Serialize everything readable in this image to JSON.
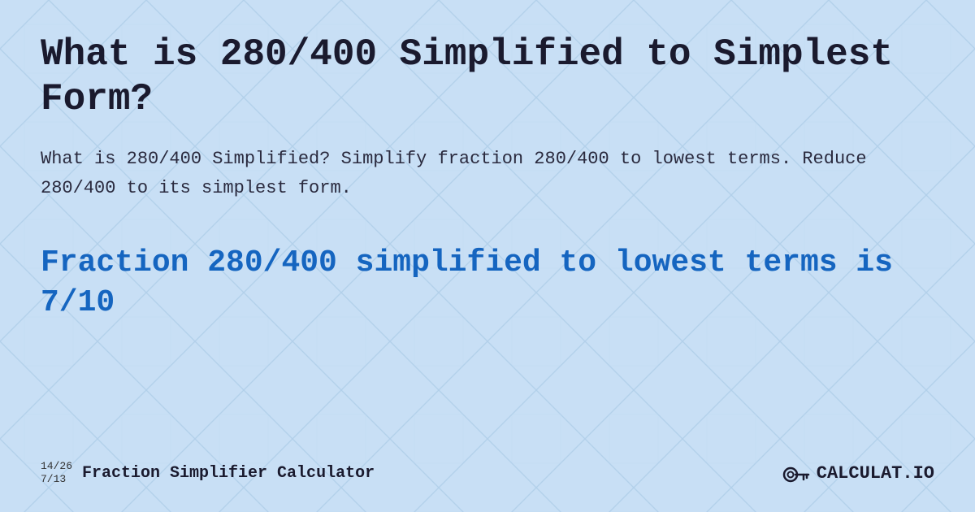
{
  "title": "What is 280/400 Simplified to Simplest Form?",
  "description": "What is 280/400 Simplified? Simplify fraction 280/400 to lowest terms. Reduce 280/400 to its simplest form.",
  "result": "Fraction 280/400 simplified to lowest terms is 7/10",
  "footer": {
    "fraction_top": "14/26",
    "fraction_bottom": "7/13",
    "calculator_name": "Fraction Simplifier Calculator",
    "logo": "CALCULAT.IO"
  },
  "colors": {
    "background": "#c8dff5",
    "title": "#1a1a2e",
    "description": "#2a2a3e",
    "result": "#1565c0"
  }
}
